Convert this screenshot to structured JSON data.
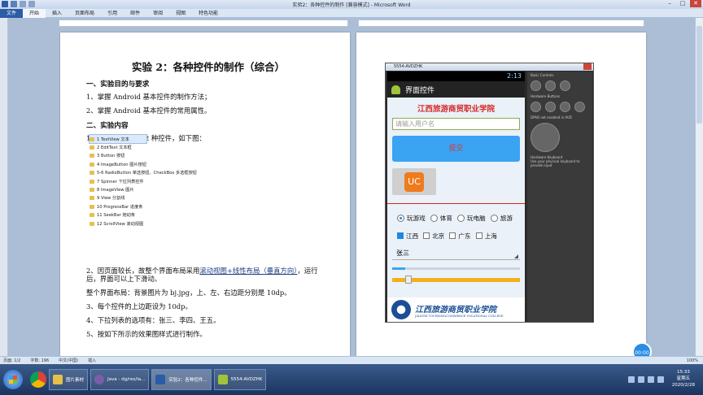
{
  "window": {
    "title": "实验2：各种控件的制作 [兼容模式] - Microsoft Word"
  },
  "ribbon": {
    "tabs": [
      "文件",
      "开始",
      "插入",
      "页面布局",
      "引用",
      "邮件",
      "审阅",
      "视图",
      "特色功能"
    ]
  },
  "doc": {
    "title": "实验 2：各种控件的制作（综合）",
    "section1": "一、实验目的与要求",
    "obj1": "1、掌握 Android 基本控件的制作方法；",
    "obj2": "2、掌握 Android 基本控件的常用属性。",
    "section2": "二、实验内容",
    "intro": "1、本实验涉及到 12 种控件，如下图：",
    "file_list": [
      "1  TextView 文本",
      "2  EditText 文本框",
      "3  Button 按钮",
      "4  ImageButton 图片按钮",
      "5-6  RadioButton 单选按钮、CheckBox 多选框按钮",
      "7  Spinner 下拉列表控件",
      "8  ImageView 图片",
      "9 View 分割线",
      "10 ProgressBar 进度条",
      "11 SeekBar 拖动条",
      "12 ScrollView 滚动视图"
    ],
    "p2_prefix": "2、因页面较长，故整个界面布局采用",
    "p2_link": "滚动视图+线性布局（垂直方向）",
    "p2_suffix": "，运行后，界面可以上下滑动。",
    "p3": "整个界面布局：背景图片为 bj.jpg，上、左、右边距分别是 10dp。",
    "p4": "3、每个控件的上边距设为 10dp。",
    "p5": "4、下拉列表的选项有：张三、李四、王五。",
    "p6": "5、按如下所示的效果图样式进行制作。"
  },
  "emulator": {
    "title": "5554:AVDZHK",
    "clock": "2:13",
    "app_title": "界面控件",
    "school": "江西旅游商贸职业学院",
    "edit_hint": "请输入用户名",
    "submit": "提交",
    "uc_glyph": "UC",
    "radios": [
      "玩游戏",
      "体育",
      "玩电脑",
      "旅游"
    ],
    "radio_checked": 0,
    "checks": [
      "江西",
      "北京",
      "广东",
      "上海"
    ],
    "checks_on": [
      true,
      false,
      false,
      false
    ],
    "spinner": "张三",
    "progress": 0.1,
    "seek": 0.1,
    "logo_cn": "江西旅游商贸职业学院",
    "logo_en": "JIANGXI TOURISM&COMMERCE VOCATIONAL COLLEGE",
    "panel_labels": [
      "Basic Controls",
      "Hardware Buttons",
      "DPAD not enabled in AVD",
      "Hardware Keyboard",
      "Use your physical keyboard to provide input"
    ]
  },
  "statusbar": {
    "page": "页面: 1/2",
    "words": "字数: 196",
    "lang": "中文(中国)",
    "mode": "插入",
    "zoom": "100%"
  },
  "taskbar": {
    "tasks": [
      "图片素材",
      "Java - dg/res/la...",
      "实验2：各种控件...",
      "5554:AVDZHK"
    ],
    "time": "15:33",
    "weekday": "星期五",
    "date": "2020/2/28"
  },
  "recorder": "00:00",
  "colors": {
    "accent_blue": "#3aa4f2",
    "school_red": "#d42a2a",
    "word_blue": "#2a5ca7"
  }
}
